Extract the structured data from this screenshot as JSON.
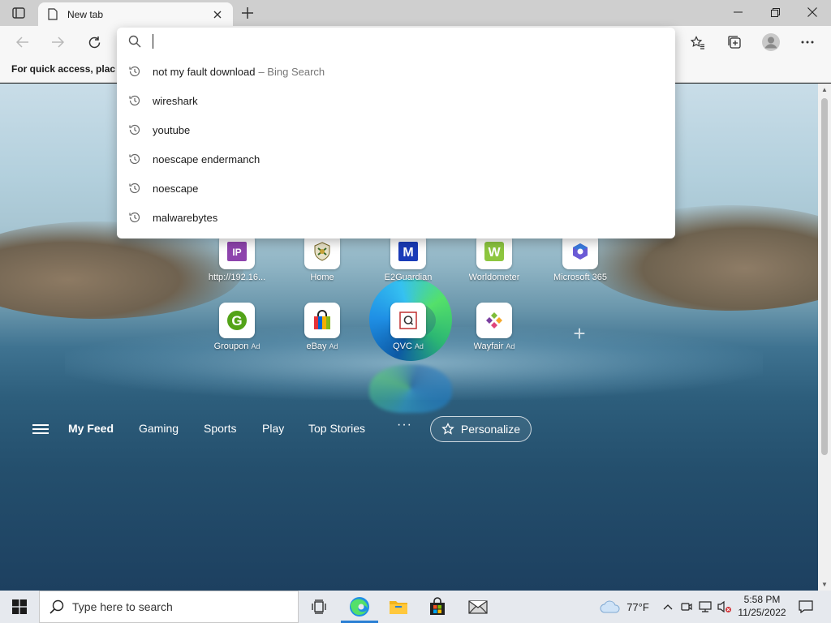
{
  "browser": {
    "tab_title": "New tab",
    "favorites_hint": "For quick access, place y"
  },
  "omnibox": {
    "value": "",
    "suggestions": [
      {
        "text": "not my fault download",
        "sub": "– Bing Search"
      },
      {
        "text": "wireshark",
        "sub": ""
      },
      {
        "text": "youtube",
        "sub": ""
      },
      {
        "text": "noescape endermanch",
        "sub": ""
      },
      {
        "text": "noescape",
        "sub": ""
      },
      {
        "text": "malwarebytes",
        "sub": ""
      }
    ]
  },
  "quick_links": {
    "row1": [
      {
        "label": "http://192.16...",
        "ad": ""
      },
      {
        "label": "Home",
        "ad": ""
      },
      {
        "label": "E2Guardian",
        "ad": ""
      },
      {
        "label": "Worldometer",
        "ad": ""
      },
      {
        "label": "Microsoft 365",
        "ad": ""
      }
    ],
    "row2": [
      {
        "label": "Groupon",
        "ad": "Ad"
      },
      {
        "label": "eBay",
        "ad": "Ad"
      },
      {
        "label": "QVC",
        "ad": "Ad"
      },
      {
        "label": "Wayfair",
        "ad": "Ad"
      }
    ]
  },
  "feed": {
    "items": [
      "My Feed",
      "Gaming",
      "Sports",
      "Play",
      "Top Stories"
    ],
    "more": "···",
    "personalize": "Personalize"
  },
  "taskbar": {
    "search_placeholder": "Type here to search",
    "weather": "77°F",
    "time": "5:58 PM",
    "date": "11/25/2022"
  },
  "colors": {
    "accent": "#2a7fd4",
    "titlebar": "#cfcfcf",
    "toolbar": "#f7f7f7"
  },
  "icons": [
    "sidebar-tabs-icon",
    "page-icon",
    "close-icon",
    "plus-icon",
    "back-icon",
    "forward-icon",
    "refresh-icon",
    "search-icon",
    "history-icon",
    "favorites-icon",
    "collections-icon",
    "profile-icon",
    "more-icon",
    "windows-start-icon",
    "task-view-icon",
    "edge-icon",
    "file-explorer-icon",
    "store-icon",
    "mail-icon",
    "cloud-icon",
    "chevron-up-icon",
    "network-icon",
    "volume-muted-icon",
    "notifications-icon"
  ]
}
